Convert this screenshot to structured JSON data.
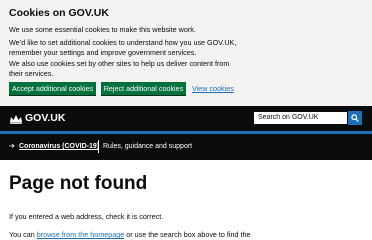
{
  "cookie_banner": {
    "title": "Cookies on GOV.UK",
    "p1": "We use some essential cookies to make this website work.",
    "p2": "We’d like to set additional cookies to understand how you use GOV.UK, remember your settings and improve government services.",
    "p3": "We also use cookies set by other sites to help us deliver content from their services.",
    "accept_label": "Accept additional cookies",
    "reject_label": "Reject additional cookies",
    "view_label": "View cookies"
  },
  "header": {
    "logo_text": "GOV.UK",
    "crown_icon": "crown-icon",
    "search_placeholder": "Search on GOV.UK",
    "search_icon": "search-icon"
  },
  "covid": {
    "link": "Coronavirus (COVID-19)",
    "desc": "Rules, guidance and support"
  },
  "main": {
    "title": "Page not found",
    "p1": "If you entered a web address, check it is correct.",
    "p2_before": "You can ",
    "p2_link": "browse from the homepage",
    "p2_after": " or use the search box above to find the"
  },
  "colors": {
    "banner_bg": "#f3f2f1",
    "button_green": "#00703c",
    "link_blue": "#1d70b8",
    "header_black": "#0b0c0c"
  }
}
